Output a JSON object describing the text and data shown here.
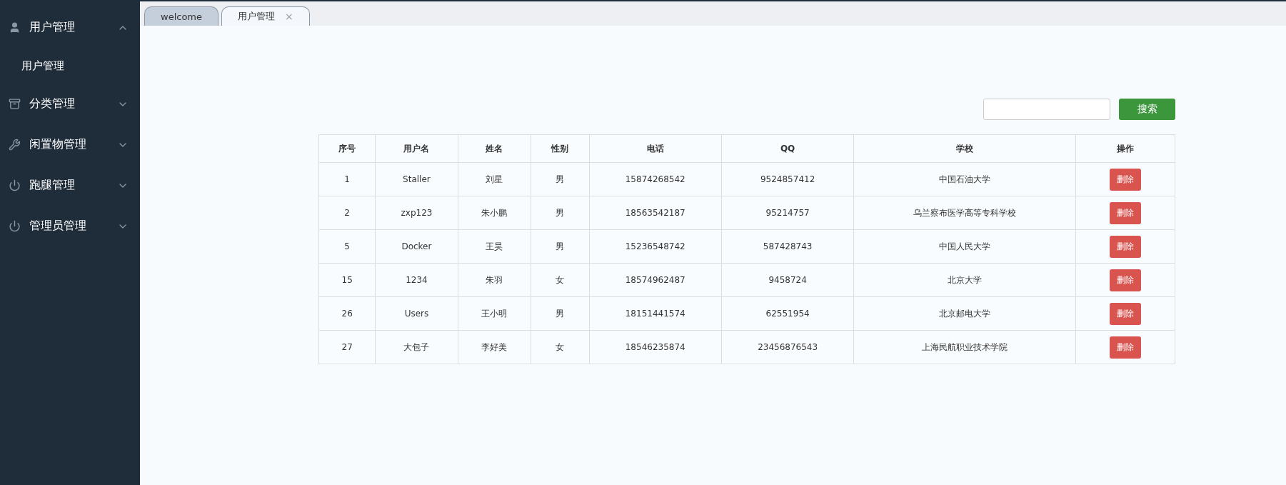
{
  "sidebar": {
    "items": [
      {
        "kind": "user",
        "label": "用户管理",
        "expanded": true,
        "children": [
          {
            "label": "用户管理"
          }
        ]
      },
      {
        "kind": "category",
        "label": "分类管理",
        "expanded": false
      },
      {
        "kind": "tools",
        "label": "闲置物管理",
        "expanded": false
      },
      {
        "kind": "power",
        "label": "跑腿管理",
        "expanded": false
      },
      {
        "kind": "power",
        "label": "管理员管理",
        "expanded": false
      }
    ]
  },
  "tabs": [
    {
      "label": "welcome",
      "selected": false
    },
    {
      "label": "用户管理",
      "selected": true,
      "close": "×"
    }
  ],
  "search": {
    "button": "搜索"
  },
  "table": {
    "columns": [
      "序号",
      "用户名",
      "姓名",
      "性别",
      "电话",
      "QQ",
      "学校",
      "操作"
    ],
    "rows": [
      {
        "cells": [
          "1",
          "Staller",
          "刘星",
          "男",
          "15874268542",
          "9524857412",
          "中国石油大学"
        ],
        "action": "删除"
      },
      {
        "cells": [
          "2",
          "zxp123",
          "朱小鹏",
          "男",
          "18563542187",
          "95214757",
          "乌兰察布医学高等专科学校"
        ],
        "action": "删除"
      },
      {
        "cells": [
          "5",
          "Docker",
          "王昊",
          "男",
          "15236548742",
          "587428743",
          "中国人民大学"
        ],
        "action": "删除"
      },
      {
        "cells": [
          "15",
          "1234",
          "朱羽",
          "女",
          "18574962487",
          "9458724",
          "北京大学"
        ],
        "action": "删除"
      },
      {
        "cells": [
          "26",
          "Users",
          "王小明",
          "男",
          "18151441574",
          "62551954",
          "北京邮电大学"
        ],
        "action": "删除"
      },
      {
        "cells": [
          "27",
          "大包子",
          "李好美",
          "女",
          "18546235874",
          "23456876543",
          "上海民航职业技术学院"
        ],
        "action": "删除"
      }
    ]
  }
}
